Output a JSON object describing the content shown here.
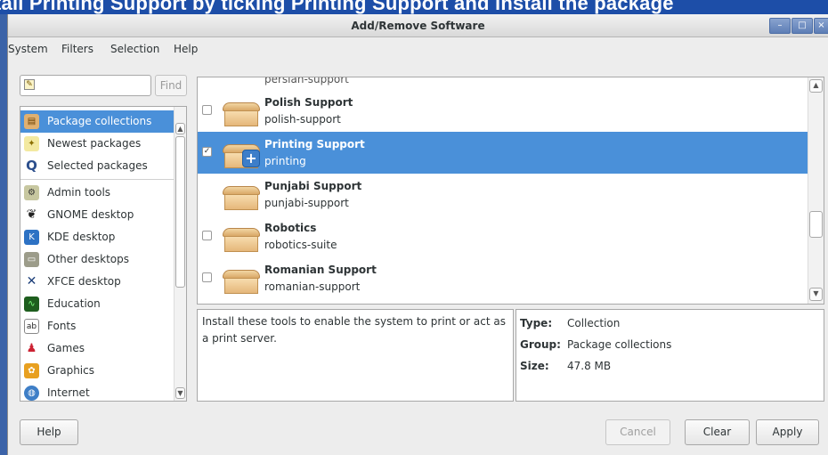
{
  "background_text": "tall Printing Support by ticking Printing Support and install the package",
  "window": {
    "title": "Add/Remove Software"
  },
  "menu": [
    "System",
    "Filters",
    "Selection",
    "Help"
  ],
  "search": {
    "value": "",
    "find_label": "Find"
  },
  "categories": [
    {
      "label": "Package collections",
      "icon": "package-icon",
      "selected": true
    },
    {
      "label": "Newest packages",
      "icon": "lightbulb-icon"
    },
    {
      "label": "Selected packages",
      "icon": "magnifier-icon"
    },
    {
      "label": "Admin tools",
      "icon": "admin-icon"
    },
    {
      "label": "GNOME desktop",
      "icon": "gnome-foot-icon"
    },
    {
      "label": "KDE desktop",
      "icon": "kde-icon"
    },
    {
      "label": "Other desktops",
      "icon": "desktop-icon"
    },
    {
      "label": "XFCE desktop",
      "icon": "xfce-mouse-icon"
    },
    {
      "label": "Education",
      "icon": "education-icon"
    },
    {
      "label": "Fonts",
      "icon": "fonts-icon"
    },
    {
      "label": "Games",
      "icon": "games-icon"
    },
    {
      "label": "Graphics",
      "icon": "graphics-icon"
    },
    {
      "label": "Internet",
      "icon": "globe-icon"
    }
  ],
  "packages": {
    "partial_top": "persian-support",
    "items": [
      {
        "name": "Polish Support",
        "id": "polish-support",
        "checked": false
      },
      {
        "name": "Printing Support",
        "id": "printing",
        "checked": true,
        "selected": true
      },
      {
        "name": "Punjabi Support",
        "id": "punjabi-support",
        "checked": false
      },
      {
        "name": "Robotics",
        "id": "robotics-suite",
        "checked": false
      },
      {
        "name": "Romanian Support",
        "id": "romanian-support",
        "checked": false
      }
    ]
  },
  "description": "Install these tools to enable the system to print or act as a print server.",
  "details": {
    "type_label": "Type:",
    "type_value": "Collection",
    "group_label": "Group:",
    "group_value": "Package collections",
    "size_label": "Size:",
    "size_value": "47.8 MB"
  },
  "buttons": {
    "help": "Help",
    "cancel": "Cancel",
    "clear": "Clear",
    "apply": "Apply"
  },
  "colors": {
    "selection": "#4a90d9",
    "titlebar_button": "#5d7eb6",
    "page_background": "#3b63a8"
  }
}
